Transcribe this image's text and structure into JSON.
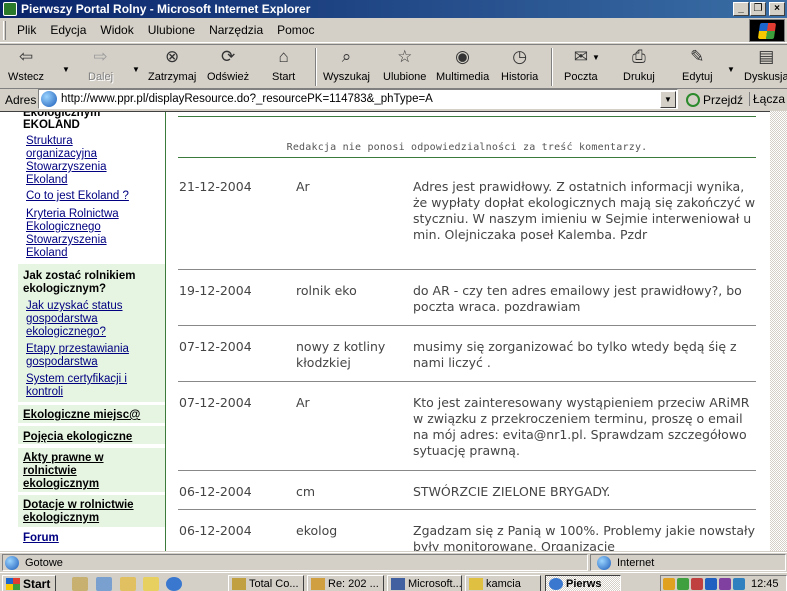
{
  "window": {
    "title": "Pierwszy Portal Rolny - Microsoft Internet Explorer",
    "min_label": "_",
    "max_label": "❐",
    "close_label": "×"
  },
  "menu": [
    {
      "label": "Plik"
    },
    {
      "label": "Edycja"
    },
    {
      "label": "Widok"
    },
    {
      "label": "Ulubione"
    },
    {
      "label": "Narzędzia"
    },
    {
      "label": "Pomoc"
    }
  ],
  "toolbar": {
    "back": "Wstecz",
    "forward": "Dalej",
    "stop": "Zatrzymaj",
    "refresh": "Odśwież",
    "home": "Start",
    "search": "Wyszukaj",
    "favorites": "Ulubione",
    "media": "Multimedia",
    "history": "Historia",
    "mail": "Poczta",
    "print": "Drukuj",
    "edit": "Edytuj",
    "discuss": "Dyskusja"
  },
  "address": {
    "label": "Adres",
    "url": "http://www.ppr.pl/displayResource.do?_resourcePK=114783&_phType=A",
    "go": "Przejdź",
    "links": "Łącza"
  },
  "sidebar": {
    "section1_title_cut": "Ekologicznym",
    "section1_title": "EKOLAND",
    "section1_links": [
      "Struktura organizacyjna Stowarzyszenia Ekoland",
      "Co to jest Ekoland ?",
      "Kryteria Rolnictwa Ekologicznego Stowarzyszenia Ekoland"
    ],
    "section2_title": "Jak zostać rolnikiem ekologicznym?",
    "section2_links": [
      "Jak uzyskać status gospodarstwa ekologicznego?",
      "Etapy przestawiania gospodarstwa",
      "System certyfikacji i kontroli"
    ],
    "bold_links": [
      "Ekologiczne miejsc@",
      "Pojęcia ekologiczne",
      "Akty prawne w rolnictwie ekologicznym",
      "Dotacje w rolnictwie ekologicznym"
    ],
    "forum": "Forum"
  },
  "main": {
    "disclaimer": "Redakcja nie ponosi odpowiedzialności za treść komentarzy.",
    "comments": [
      {
        "date": "21-12-2004",
        "author": "Ar",
        "text": "Adres jest prawidłowy. Z ostatnich informacji wynika, że wypłaty dopłat ekologicznych mają się zakończyć w styczniu. W naszym imieniu w Sejmie interweniował u min. Olejniczaka poseł Kalemba. Pzdr"
      },
      {
        "date": "19-12-2004",
        "author": "rolnik eko",
        "text": "do AR - czy ten adres emailowy jest prawidłowy?, bo poczta wraca. pozdrawiam"
      },
      {
        "date": "07-12-2004",
        "author": "nowy z kotliny kłodzkiej",
        "text": "musimy się zorganizować bo tylko wtedy będą śię z nami liczyć ."
      },
      {
        "date": "07-12-2004",
        "author": "Ar",
        "text": "Kto jest zainteresowany wystąpieniem przeciw ARiMR w związku z przekroczeniem terminu, proszę o email na mój adres: evita@nr1.pl. Sprawdzam szczegółowo sytuację prawną."
      },
      {
        "date": "06-12-2004",
        "author": "cm",
        "text": "STWÓRZCIE ZIELONE BRYGADY."
      },
      {
        "date": "06-12-2004",
        "author": "ekolog",
        "text": "Zgadzam się z Panią w 100%. Problemy jakie nowstały były monitorowane. Organizacje"
      }
    ]
  },
  "status": {
    "left": "Gotowe",
    "zone": "Internet"
  },
  "taskbar": {
    "start": "Start",
    "tasks": [
      "Total Co...",
      "Re: 202 ...",
      "Microsoft...",
      "kamcia",
      "Pierws"
    ],
    "clock": "12:45"
  }
}
